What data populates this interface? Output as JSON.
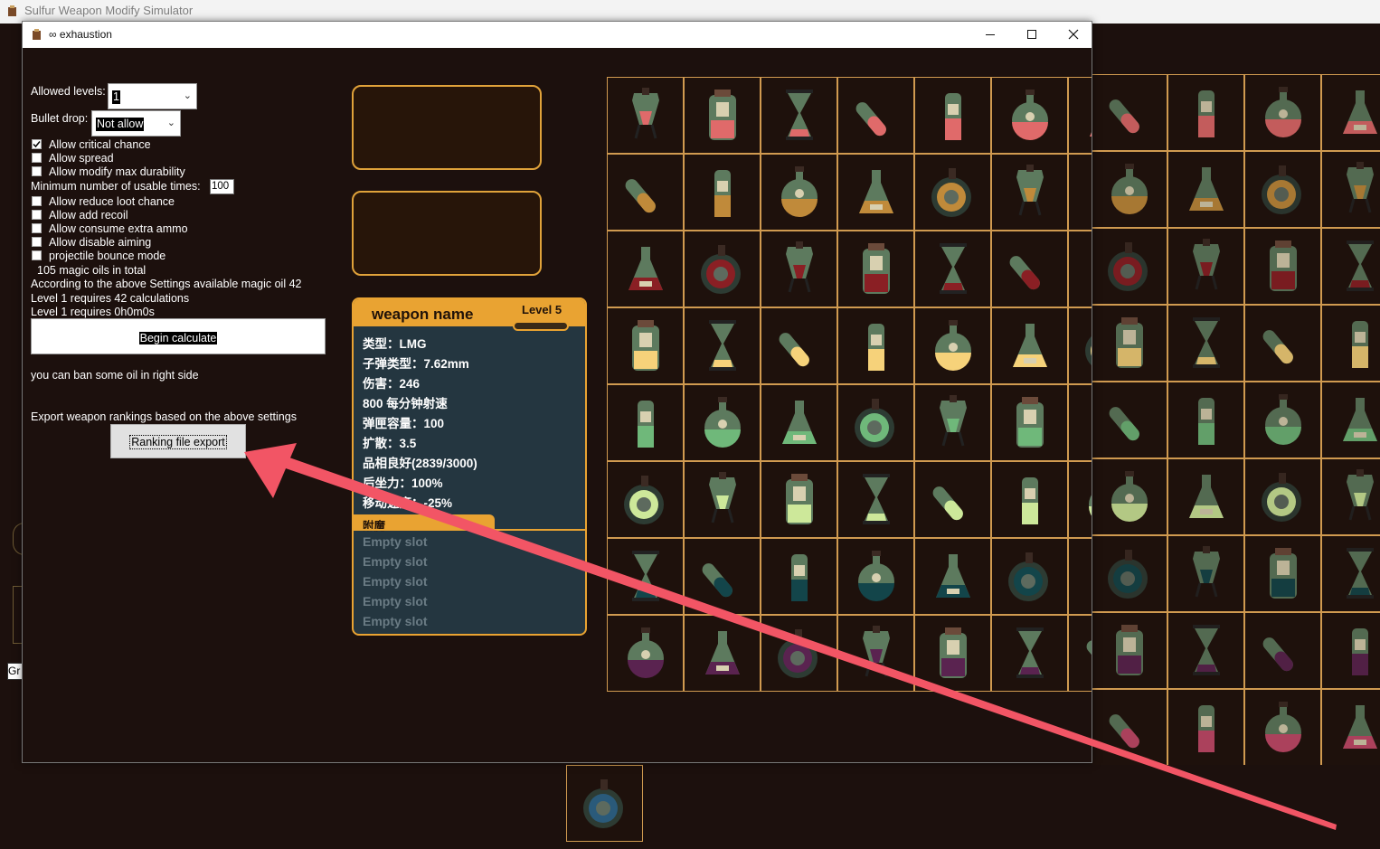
{
  "main_window": {
    "title": "Sulfur Weapon Modify Simulator",
    "partial_text": "Gr"
  },
  "dialog": {
    "title": "∞ exhaustion",
    "buttons": [
      "minimize",
      "maximize",
      "close"
    ]
  },
  "settings": {
    "allowed_levels_label": "Allowed levels:",
    "allowed_levels_value": "1",
    "bullet_drop_label": "Bullet drop:",
    "bullet_drop_value": "Not allow",
    "checkboxes": [
      {
        "label": "Allow critical chance",
        "checked": true
      },
      {
        "label": "Allow spread",
        "checked": false
      },
      {
        "label": "Allow modify max durability",
        "checked": false
      }
    ],
    "min_uses_label": "Minimum number of usable times:",
    "min_uses_value": "100",
    "checkboxes2": [
      {
        "label": "Allow reduce loot chance",
        "checked": false
      },
      {
        "label": "Allow add recoil",
        "checked": false
      },
      {
        "label": "Allow consume extra ammo",
        "checked": false
      },
      {
        "label": "Allow disable aiming",
        "checked": false
      },
      {
        "label": "projectile bounce mode",
        "checked": false
      }
    ],
    "info_total": "105 magic oils in total",
    "info_available": "According to the above Settings available magic oil 42",
    "info_calc": "Level 1 requires 42 calculations",
    "info_time": "Level 1 requires 0h0m0s",
    "begin_button": "Begin calculate",
    "ban_hint": "you can ban some oil in right side",
    "export_hint": "Export weapon rankings based on the above settings",
    "export_button": "Ranking file export"
  },
  "weapon": {
    "name": "weapon name",
    "level": "Level 5",
    "stats": [
      "类型：LMG",
      "子弹类型：7.62mm",
      "伤害：246",
      "800 每分钟射速",
      "弹匣容量：100",
      "扩散：3.5",
      "品相良好(2839/3000)",
      "后坐力：100%",
      "移动速度：-25%"
    ],
    "enchant_label": "附魔",
    "slots": [
      "Empty slot",
      "Empty slot",
      "Empty slot",
      "Empty slot",
      "Empty slot"
    ]
  },
  "colors": {
    "background": "#1c100d",
    "accent": "#e9a332",
    "card_bg": "#243640",
    "arrow": "#f25565"
  },
  "oil_colors": [
    [
      "#e06a6a",
      "#e06a6a",
      "#e06a6a",
      "#e06a6a",
      "#e06a6a",
      "#e06a6a"
    ],
    [
      "#c08a3a",
      "#c08a3a",
      "#c08a3a",
      "#c08a3a",
      "#c08a3a",
      "#c08a3a"
    ],
    [
      "#8a1f24",
      "#8a1f24",
      "#8a1f24",
      "#8a1f24",
      "#8a1f24",
      "#8a1f24"
    ],
    [
      "#f6d27a",
      "#f6d27a",
      "#f6d27a",
      "#f6d27a",
      "#f6d27a",
      "#f6d27a"
    ],
    [
      "#6fb87a",
      "#6fb87a",
      "#6fb87a",
      "#6fb87a",
      "#6fb87a",
      "#6fb87a"
    ],
    [
      "#cde89a",
      "#cde89a",
      "#cde89a",
      "#cde89a",
      "#cde89a",
      "#cde89a"
    ],
    [
      "#13454a",
      "#13454a",
      "#13454a",
      "#13454a",
      "#13454a",
      "#13454a"
    ],
    [
      "#5a2350",
      "#5a2350",
      "#5a2350",
      "#5a2350",
      "#5a2350",
      "#5a2350"
    ]
  ],
  "bg_oil_colors": [
    "#e06a6a",
    "#c08a3a",
    "#8a1f24",
    "#f6d27a",
    "#6fb87a",
    "#cde89a",
    "#13454a",
    "#5a2350",
    "#c44a6a"
  ]
}
